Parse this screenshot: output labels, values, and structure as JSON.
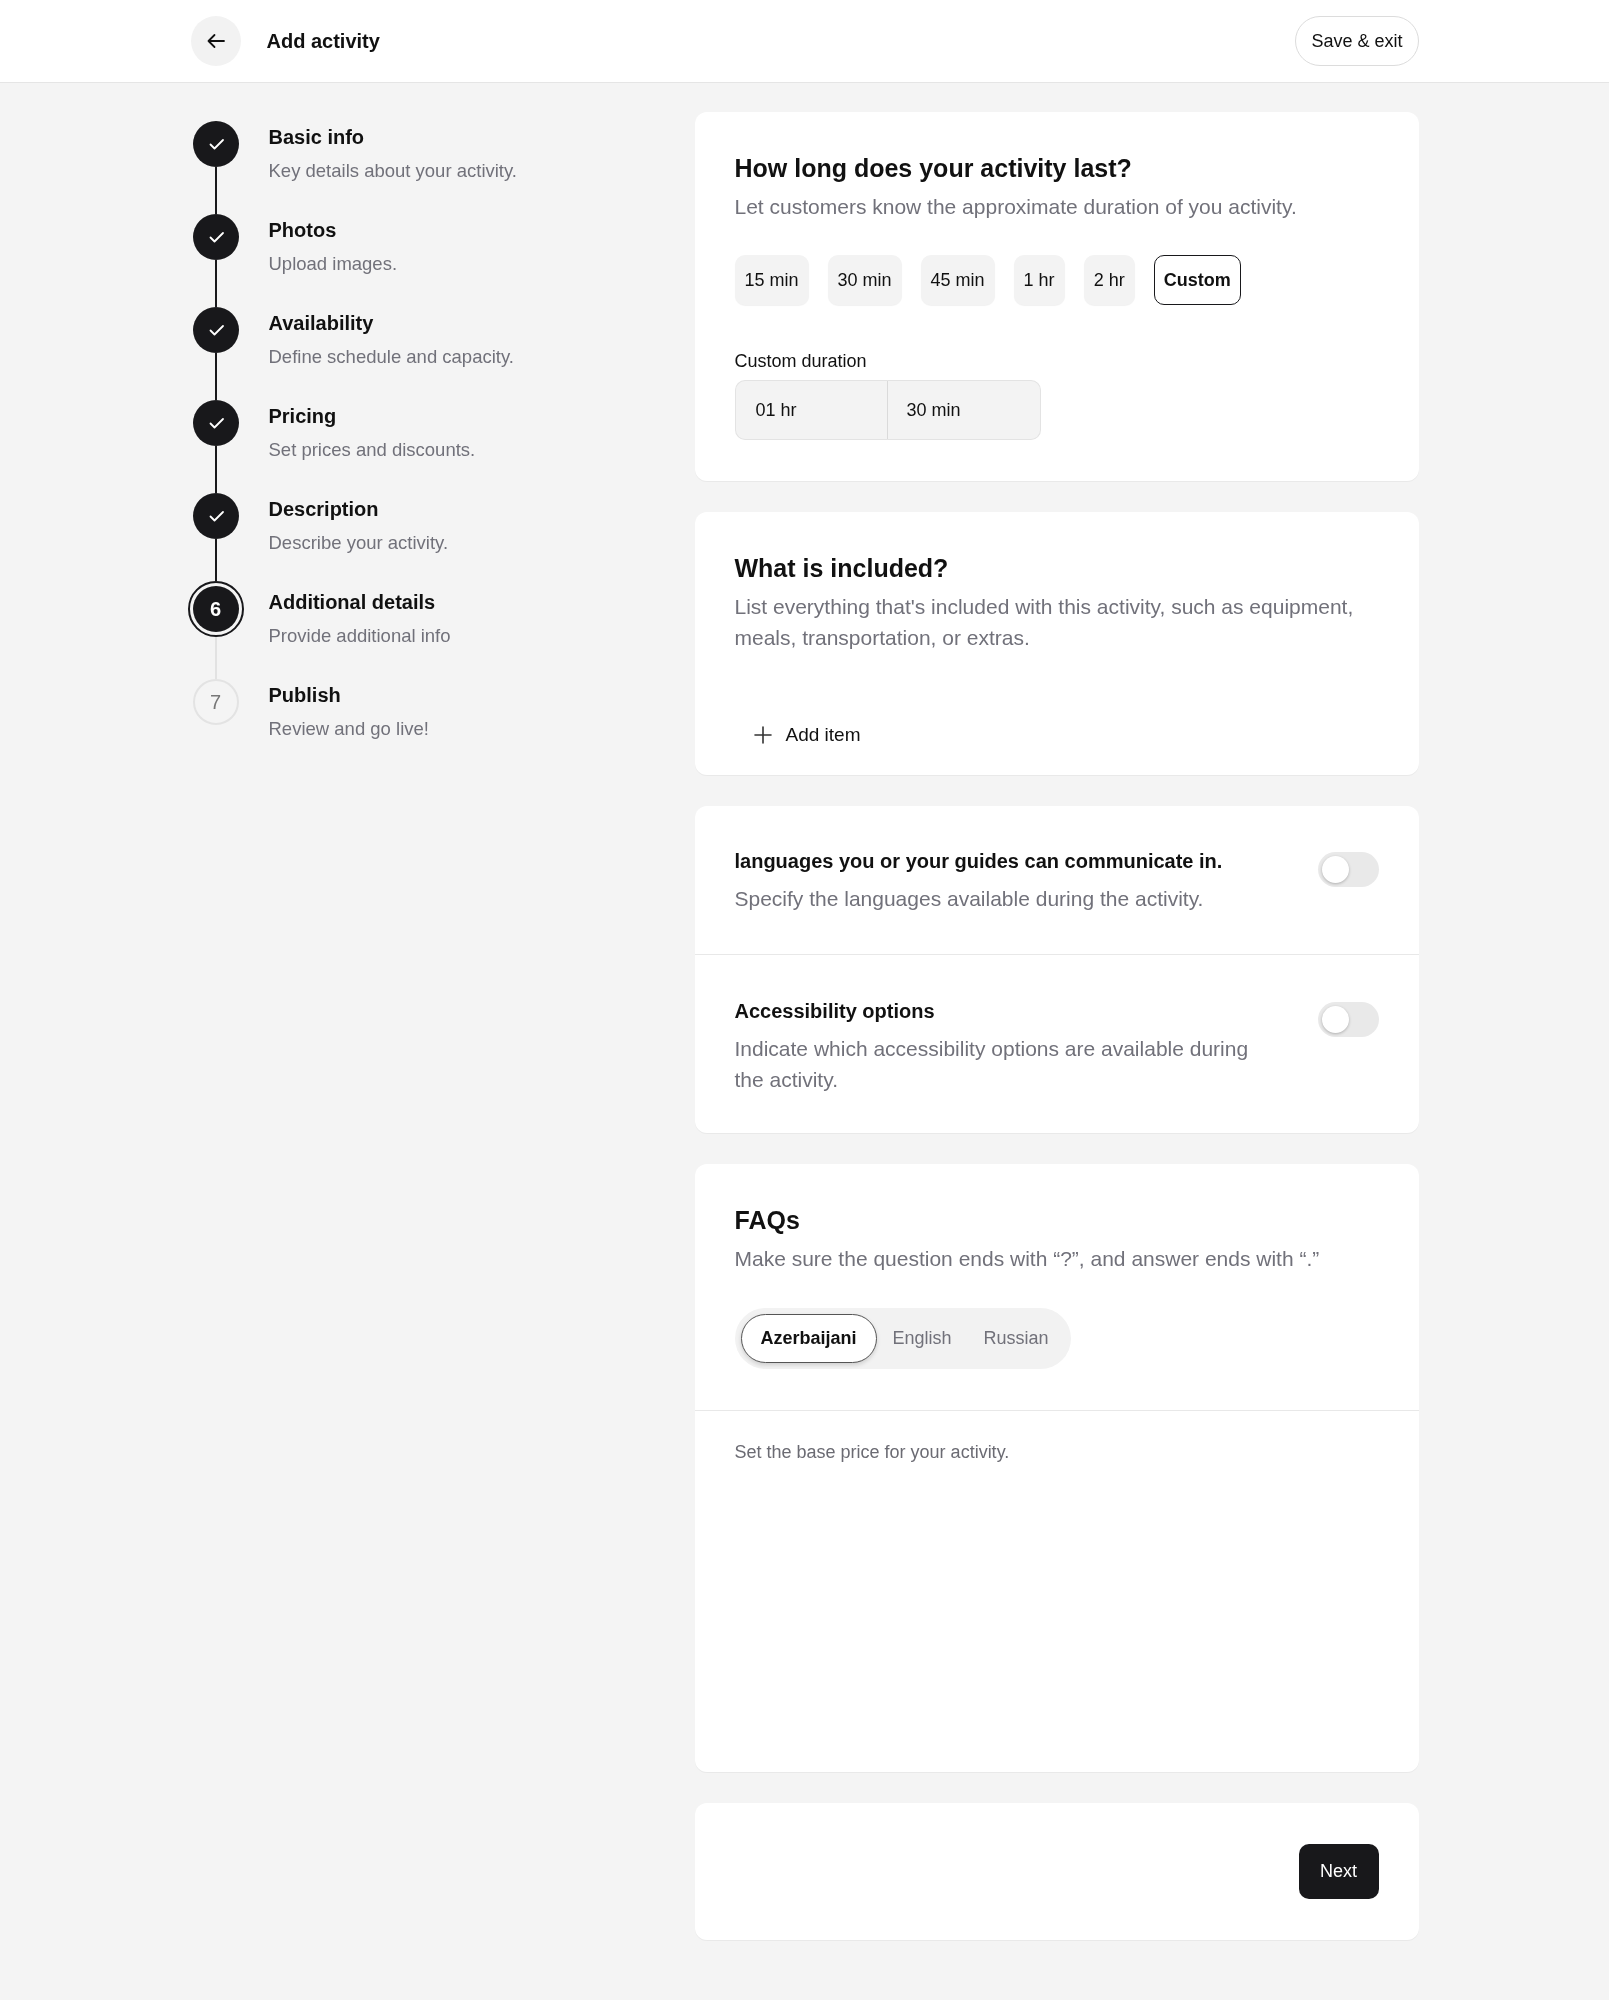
{
  "header": {
    "title": "Add activity",
    "save_button": "Save & exit"
  },
  "steps": [
    {
      "title": "Basic info",
      "description": "Key details about your activity.",
      "completed": true,
      "selected": false
    },
    {
      "title": "Photos",
      "description": "Upload images.",
      "completed": true,
      "selected": false
    },
    {
      "title": "Availability",
      "description": "Define schedule and capacity.",
      "completed": true,
      "selected": false
    },
    {
      "title": "Pricing",
      "description": "Set prices and discounts.",
      "completed": true,
      "selected": false
    },
    {
      "title": "Description",
      "description": "Describe your activity.",
      "completed": true,
      "selected": false
    },
    {
      "number": "6",
      "title": "Additional details",
      "description": "Provide additional info",
      "completed": false,
      "selected": true
    },
    {
      "number": "7",
      "title": "Publish",
      "description": "Review and go live!",
      "completed": false,
      "selected": false
    }
  ],
  "duration": {
    "title": "How long does your activity last?",
    "description": "Let customers know the approximate duration of you activity.",
    "options": [
      {
        "label": "15 min",
        "selected": false
      },
      {
        "label": "30 min",
        "selected": false
      },
      {
        "label": "45 min",
        "selected": false
      },
      {
        "label": "1 hr",
        "selected": false
      },
      {
        "label": "2 hr",
        "selected": false
      },
      {
        "label": "Custom",
        "selected": true
      }
    ],
    "custom_duration": {
      "label": "Custom duration",
      "hours": "01 hr",
      "minutes": "30 min"
    }
  },
  "included": {
    "title": "What is included?",
    "description": "List everything that's included with this activity, such as equipment, meals, transportation, or extras.",
    "add_button": "Add item"
  },
  "settings": [
    {
      "title": "languages you or your guides can communicate in.",
      "description": "Specify the languages available during the activity.",
      "on": false
    },
    {
      "title": "Accessibility options",
      "description": "Indicate which accessibility options are available during the activity.",
      "on": false
    }
  ],
  "faqs": {
    "title": "FAQs",
    "description": "Make sure the question ends with “?”, and answer ends with “.”",
    "languages": [
      {
        "label": "Azerbaijani",
        "selected": true
      },
      {
        "label": "English",
        "selected": false
      },
      {
        "label": "Russian",
        "selected": false
      }
    ],
    "note": "Set the base price for your activity."
  },
  "footer": {
    "next_button": "Next"
  }
}
